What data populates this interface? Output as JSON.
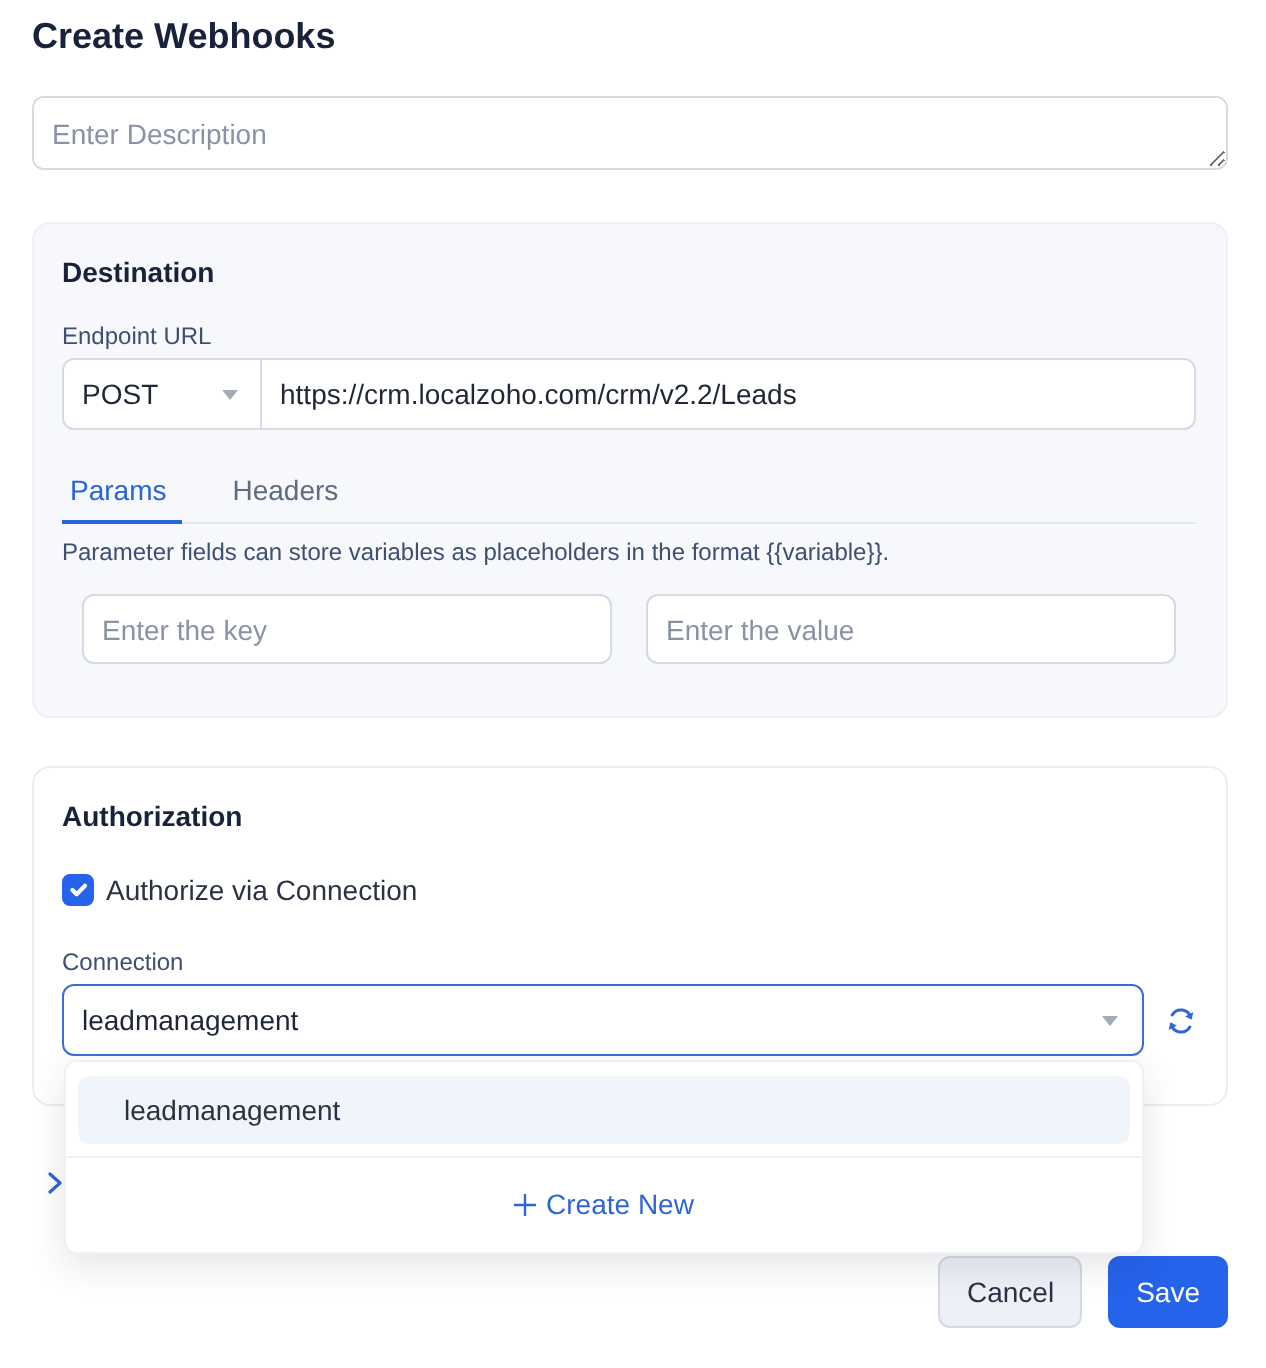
{
  "title": "Create Webhooks",
  "description_field": {
    "placeholder": "Enter Description"
  },
  "destination": {
    "heading": "Destination",
    "endpoint_label": "Endpoint URL",
    "method": "POST",
    "url": "https://crm.localzoho.com/crm/v2.2/Leads",
    "tabs": [
      {
        "label": "Params",
        "selected": true
      },
      {
        "label": "Headers",
        "selected": false
      }
    ],
    "help_text": "Parameter fields can store variables as placeholders in the format {{variable}}.",
    "key_field": {
      "placeholder": "Enter the key"
    },
    "value_field": {
      "placeholder": "Enter the value"
    }
  },
  "authorization": {
    "heading": "Authorization",
    "authorize_via_connection": {
      "label": "Authorize via Connection",
      "checked": true
    },
    "connection_label": "Connection",
    "connection": {
      "value": "leadmanagement",
      "expanded": true
    }
  },
  "connection_dropdown": {
    "options": [
      {
        "label": "leadmanagement",
        "selected": true
      }
    ],
    "create_new": "Create New"
  },
  "buttons": [
    {
      "label": "Cancel",
      "kind": "secondary"
    },
    {
      "label": "Save",
      "kind": "primary"
    }
  ]
}
